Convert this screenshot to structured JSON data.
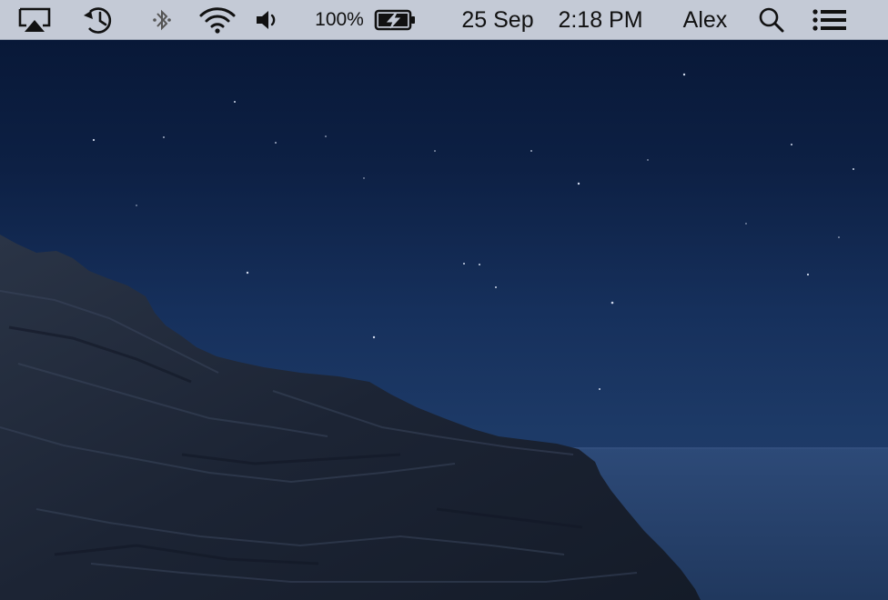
{
  "menubar": {
    "icons": {
      "airplay": "airplay-icon",
      "time_machine": "time-machine-icon",
      "bluetooth": "bluetooth-icon",
      "wifi": "wifi-icon",
      "volume": "volume-icon",
      "battery": "battery-charging-icon",
      "spotlight": "search-icon",
      "notification_center": "notification-center-icon"
    },
    "battery_percent": "100%",
    "date": "25 Sep",
    "time": "2:18 PM",
    "user_name": "Alex"
  },
  "desktop": {
    "wallpaper": "night-sea-cliff",
    "colors": {
      "menubar_bg": "#c4cad6",
      "sky_top": "#071634",
      "sky_horizon": "#24406b",
      "sea": "#2a4672",
      "cliff": "#1c2535"
    }
  }
}
